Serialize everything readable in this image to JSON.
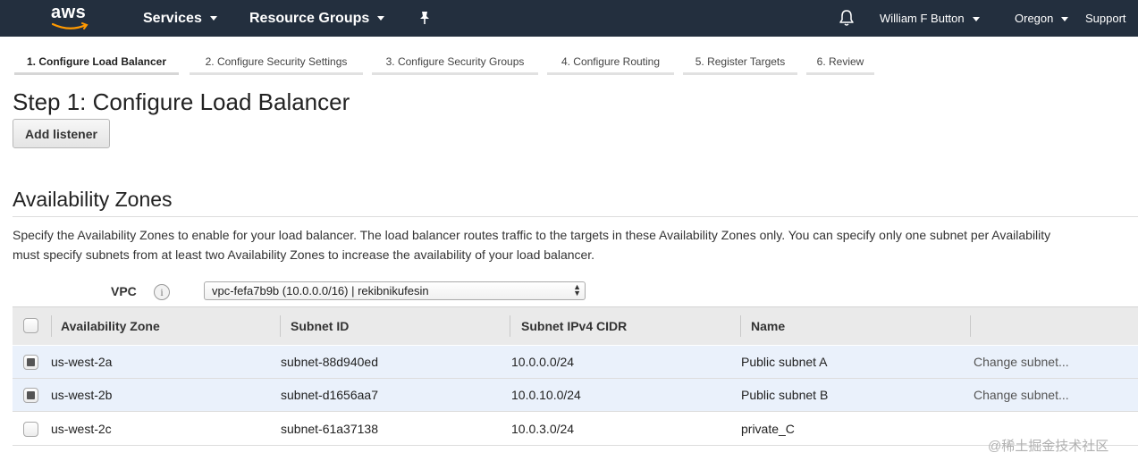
{
  "topbar": {
    "logo_text": "aws",
    "services_label": "Services",
    "resource_groups_label": "Resource Groups",
    "pin_icon": "pin-icon",
    "bell_icon": "bell-icon",
    "user_label": "William F Button",
    "region_label": "Oregon",
    "support_label": "Support",
    "background_color": "#232f3e"
  },
  "wizard": {
    "steps": [
      {
        "label": "1. Configure Load Balancer",
        "active": true
      },
      {
        "label": "2. Configure Security Settings",
        "active": false
      },
      {
        "label": "3. Configure Security Groups",
        "active": false
      },
      {
        "label": "4. Configure Routing",
        "active": false
      },
      {
        "label": "5. Register Targets",
        "active": false
      },
      {
        "label": "6. Review",
        "active": false
      }
    ]
  },
  "page": {
    "title": "Step 1: Configure Load Balancer",
    "add_listener_label": "Add listener"
  },
  "availability_zones": {
    "title": "Availability Zones",
    "description_line1": "Specify the Availability Zones to enable for your load balancer. The load balancer routes traffic to the targets in these Availability Zones only. You can specify only one subnet per Availability",
    "description_line2": "must specify subnets from at least two Availability Zones to increase the availability of your load balancer.",
    "vpc_label": "VPC",
    "info_icon": "info-icon",
    "vpc_value": "vpc-fefa7b9b (10.0.0.0/16) | rekibnikufesin",
    "columns": [
      "Availability Zone",
      "Subnet ID",
      "Subnet IPv4 CIDR",
      "Name"
    ],
    "rows": [
      {
        "zone": "us-west-2a",
        "subnet_id": "subnet-88d940ed",
        "cidr": "10.0.0.0/24",
        "name": "Public subnet A",
        "action": "Change subnet...",
        "checked": true
      },
      {
        "zone": "us-west-2b",
        "subnet_id": "subnet-d1656aa7",
        "cidr": "10.0.10.0/24",
        "name": "Public subnet B",
        "action": "Change subnet...",
        "checked": true
      },
      {
        "zone": "us-west-2c",
        "subnet_id": "subnet-61a37138",
        "cidr": "10.0.3.0/24",
        "name": "private_C",
        "action": "",
        "checked": false
      }
    ]
  },
  "watermark": "@稀土掘金技术社区"
}
